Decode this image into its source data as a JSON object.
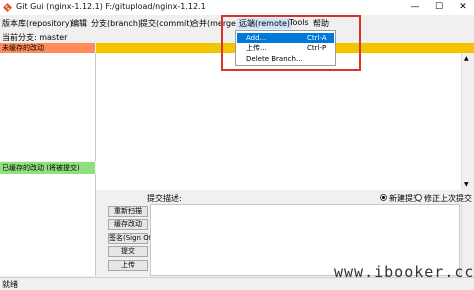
{
  "window": {
    "title": "Git Gui (nginx-1.12.1) F:/gitupload/nginx-1.12.1",
    "minimize_glyph": "—",
    "maximize_glyph": "☐",
    "close_glyph": "✕",
    "icon": "git-diamond-icon"
  },
  "menubar": {
    "items": [
      "版本库(repository)",
      "编辑",
      "分支(branch)",
      "提交(commit)",
      "合并(merge)",
      "远端(remote)",
      "Tools",
      "帮助"
    ]
  },
  "current_branch": "当前分支: master",
  "panels": {
    "unstaged": "未缓存的改动",
    "staged": "已缓存的改动 (将被提交)"
  },
  "commit": {
    "label": "提交描述:",
    "radio_new": "新建提交",
    "radio_amend": "修正上次提交",
    "buttons": [
      "重新扫描",
      "缓存改动",
      "签名(Sign Off)",
      "提交",
      "上传"
    ]
  },
  "dropdown": {
    "items": [
      {
        "label": "Add...",
        "shortcut": "Ctrl-A"
      },
      {
        "label": "上传...",
        "shortcut": "Ctrl-P"
      },
      {
        "label": "Delete Branch...",
        "shortcut": ""
      }
    ]
  },
  "status": "就绪",
  "watermark": "www.ibooker.cc",
  "colors": {
    "unstaged_header": "#ff8c5a",
    "staged_header": "#8fe07f",
    "diff_header": "#f5c400",
    "menu_highlight": "#0078d7",
    "annotation_box": "#d9342b"
  }
}
